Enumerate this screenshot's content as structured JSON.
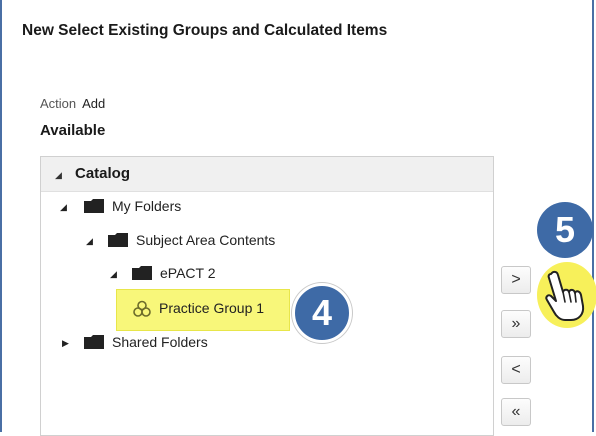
{
  "dialog": {
    "title": "New Select Existing Groups and Calculated Items",
    "action_label": "Action",
    "action_value": "Add",
    "available_label": "Available"
  },
  "tree": {
    "header": "Catalog",
    "nodes": {
      "my_folders": "My Folders",
      "subject_area_contents": "Subject Area Contents",
      "epact2": "ePACT 2",
      "practice_group": "Practice Group 1",
      "shared_folders": "Shared Folders"
    }
  },
  "transfer_buttons": {
    "move": ">",
    "move_all": "»",
    "remove": "<",
    "remove_all": "«"
  },
  "callouts": {
    "step4": "4",
    "step5": "5"
  },
  "colors": {
    "badge": "#3e6aa6",
    "highlight": "#f8f77a",
    "dialog_border": "#4a6fa5"
  }
}
